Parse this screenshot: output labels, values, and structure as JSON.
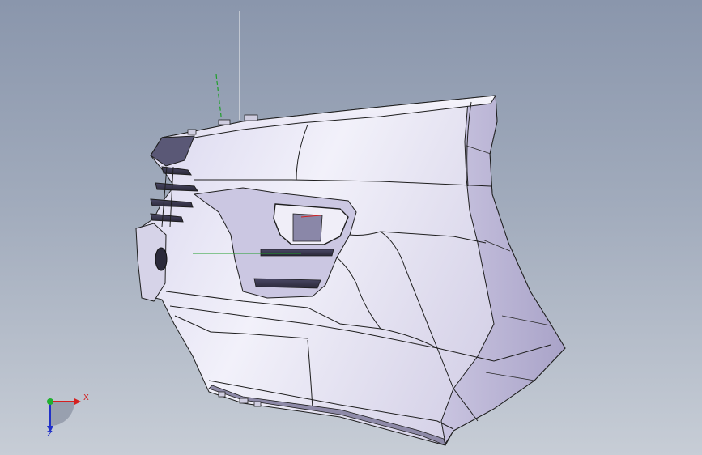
{
  "viewport": {
    "background_top": "#8a96ac",
    "background_bottom": "#c7cdd6"
  },
  "model": {
    "name": "bumper-model",
    "surface_color": "#e8e6f4",
    "shade_color": "#bdb8d6",
    "edge_color": "#2a2a2a"
  },
  "triad": {
    "x_label": "X",
    "z_label": "Z",
    "x_color": "#d42020",
    "y_color": "#20b030",
    "z_color": "#2030c8"
  }
}
